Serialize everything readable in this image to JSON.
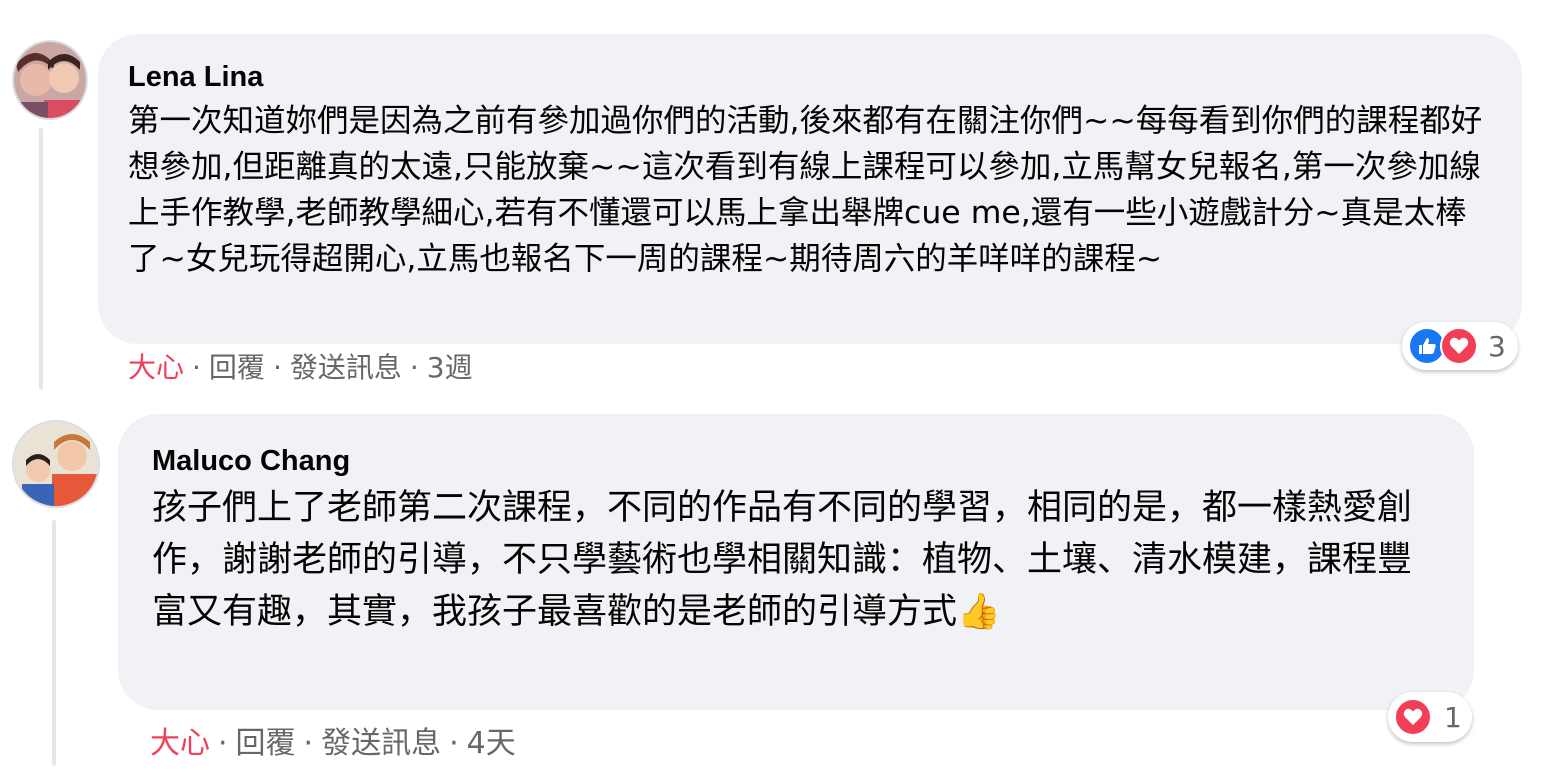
{
  "comments": [
    {
      "author": "Lena Lina",
      "text": "第一次知道妳們是因為之前有參加過你們的活動,後來都有在關注你們~~每每看到你們的課程都好想參加,但距離真的太遠,只能放棄~~這次看到有線上課程可以參加,立馬幫女兒報名,第一次參加線上手作教學,老師教學細心,若有不懂還可以馬上拿出舉牌cue me,還有一些小遊戲計分~真是太棒了~女兒玩得超開心,立馬也報名下一周的課程~期待周六的羊咩咩的課程~",
      "action_love": "大心",
      "action_reply": "回覆",
      "action_message": "發送訊息",
      "time": "3週",
      "reaction_count": "3",
      "reactions": [
        "like-icon",
        "love-icon"
      ]
    },
    {
      "author": "Maluco Chang",
      "text": "孩子們上了老師第二次課程，不同的作品有不同的學習，相同的是，都一樣熱愛創作，謝謝老師的引導，不只學藝術也學相關知識：植物、土壤、清水模建，課程豐富又有趣，其實，我孩子最喜歡的是老師的引導方式👍",
      "action_love": "大心",
      "action_reply": "回覆",
      "action_message": "發送訊息",
      "time": "4天",
      "reaction_count": "1",
      "reactions": [
        "love-icon"
      ]
    }
  ],
  "separator": "·",
  "colors": {
    "bubble": "#f0f2f5",
    "love": "#f33e58",
    "like": "#1877f2",
    "meta": "#65676b"
  }
}
